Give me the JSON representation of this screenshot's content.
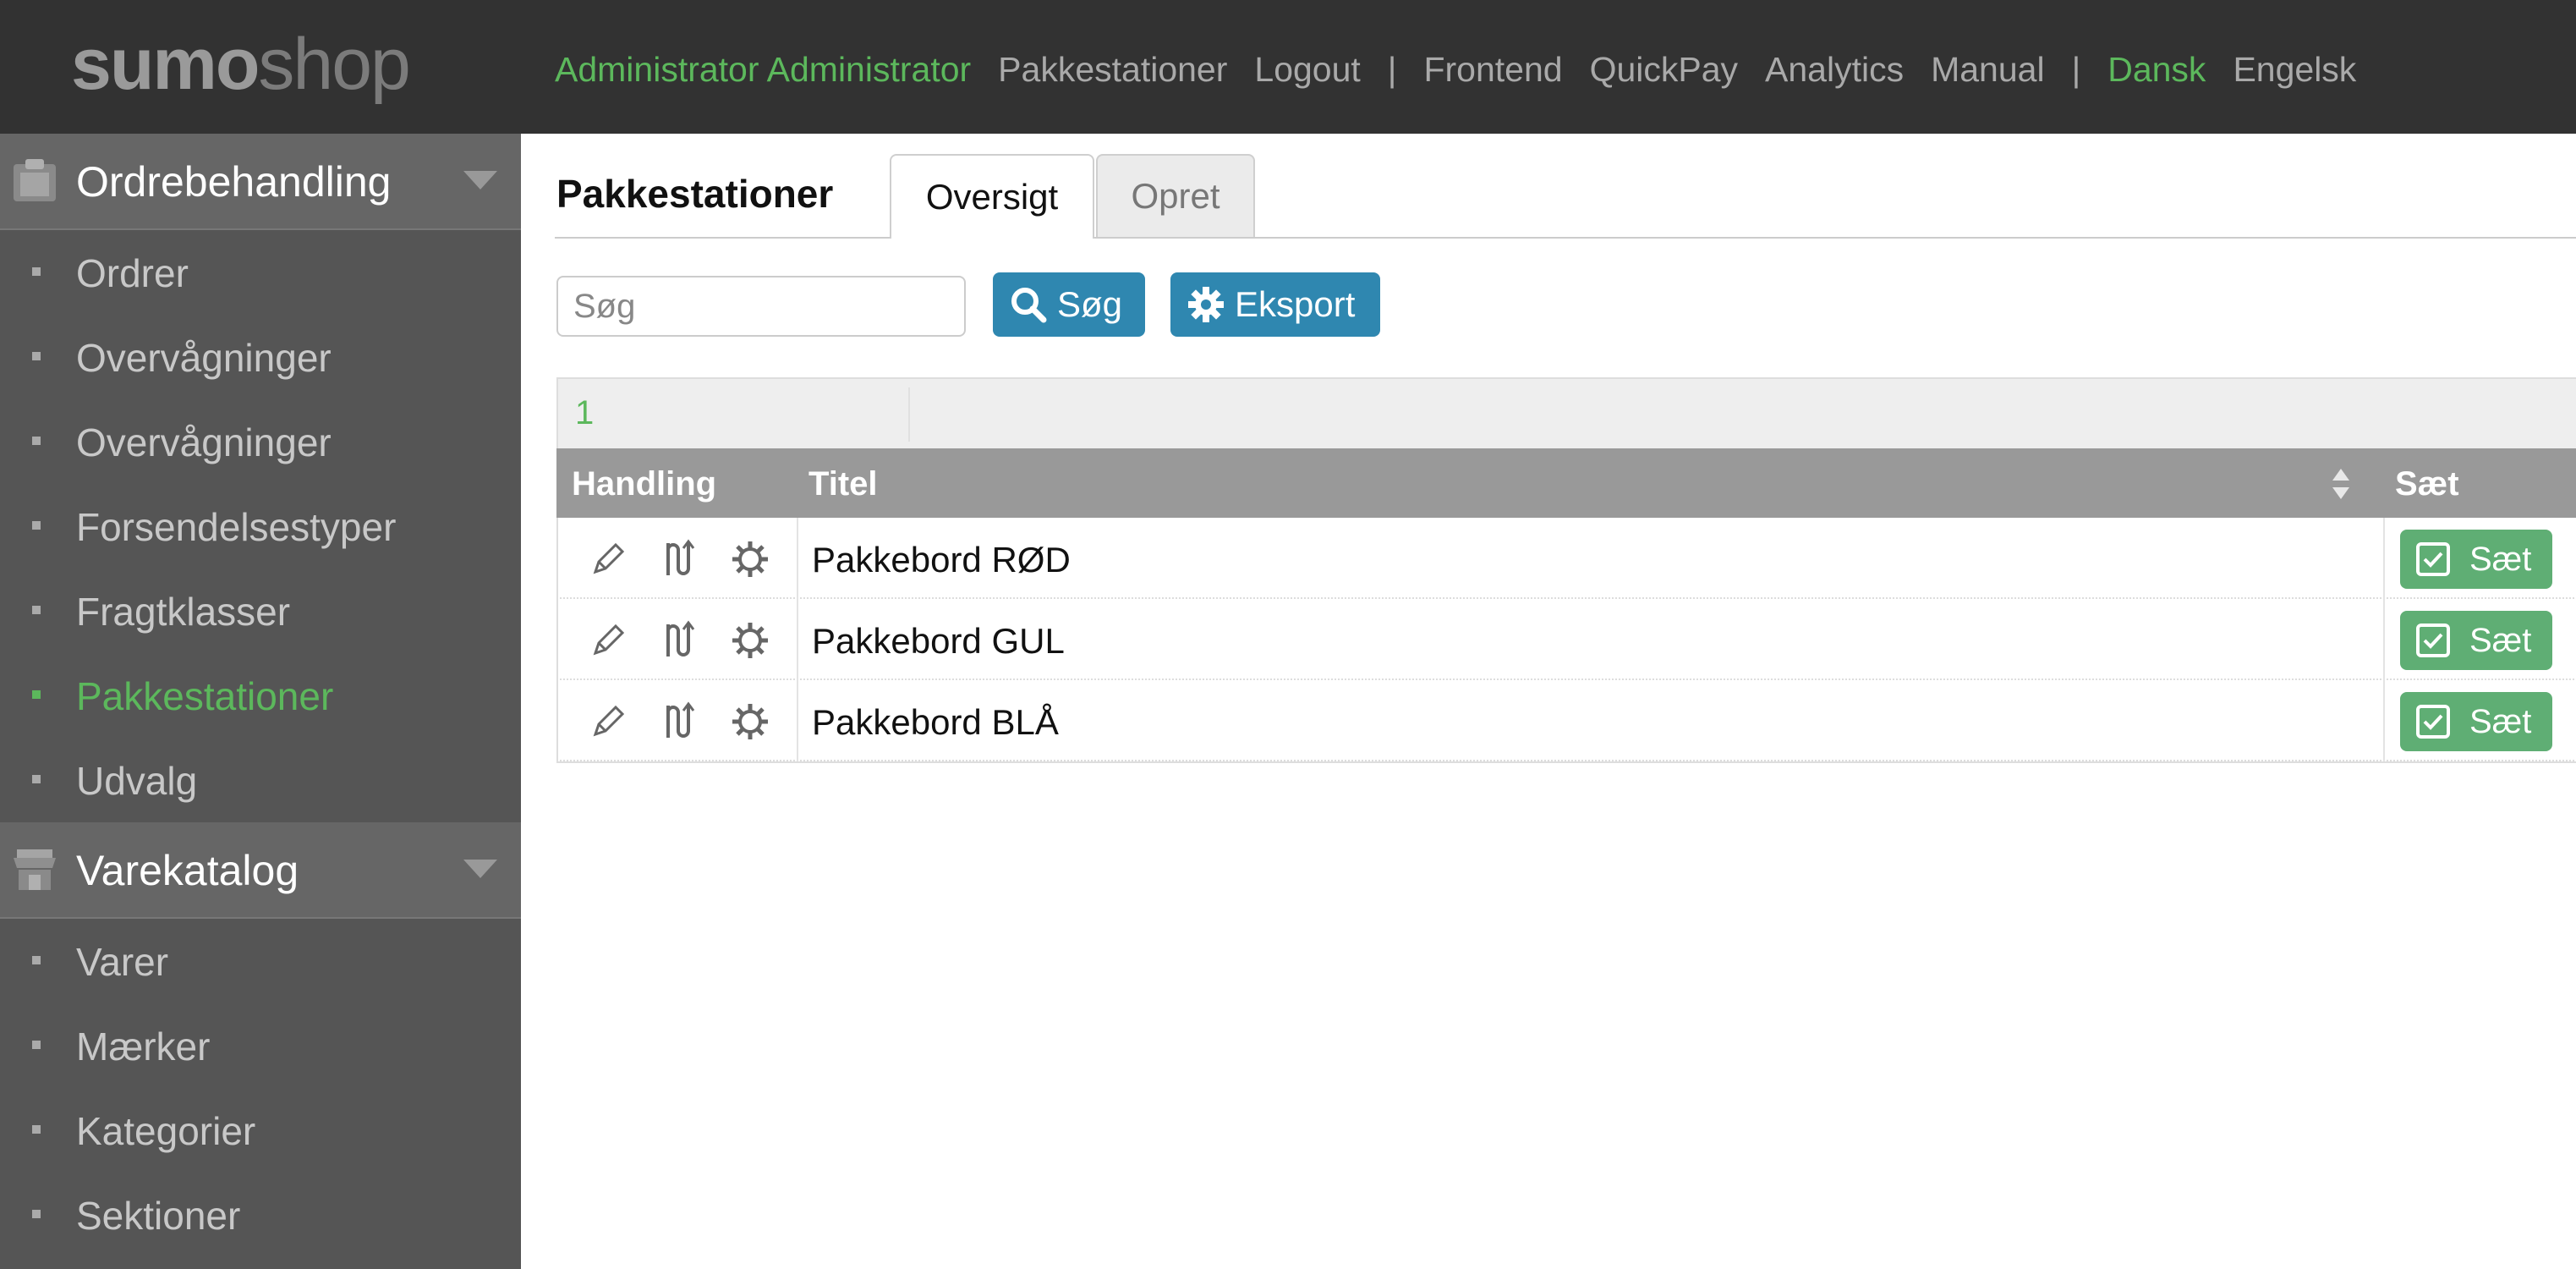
{
  "logo": {
    "part1": "sumo",
    "part2": "shop"
  },
  "topnav": {
    "user": "Administrator Administrator",
    "pakkestationer": "Pakkestationer",
    "logout": "Logout",
    "sep1": "|",
    "frontend": "Frontend",
    "quickpay": "QuickPay",
    "analytics": "Analytics",
    "manual": "Manual",
    "sep2": "|",
    "dansk": "Dansk",
    "engelsk": "Engelsk"
  },
  "sidebar": {
    "section1": {
      "title": "Ordrebehandling",
      "icon": "clipboard-icon"
    },
    "section1_items": [
      {
        "label": "Ordrer"
      },
      {
        "label": "Overvågninger"
      },
      {
        "label": "Overvågninger"
      },
      {
        "label": "Forsendelsestyper"
      },
      {
        "label": "Fragtklasser"
      },
      {
        "label": "Pakkestationer",
        "active": true
      },
      {
        "label": "Udvalg"
      }
    ],
    "section2": {
      "title": "Varekatalog",
      "icon": "store-icon"
    },
    "section2_items": [
      {
        "label": "Varer"
      },
      {
        "label": "Mærker"
      },
      {
        "label": "Kategorier"
      },
      {
        "label": "Sektioner"
      }
    ]
  },
  "main": {
    "title": "Pakkestationer",
    "tabs": [
      {
        "label": "Oversigt"
      },
      {
        "label": "Opret"
      }
    ],
    "search": {
      "placeholder": "Søg",
      "button": "Søg"
    },
    "export_button": "Eksport",
    "pager": {
      "page": "1"
    },
    "table": {
      "headers": {
        "action": "Handling",
        "title": "Titel",
        "set": "Sæt"
      },
      "rows": [
        {
          "title": "Pakkebord RØD",
          "set_label": "Sæt"
        },
        {
          "title": "Pakkebord GUL",
          "set_label": "Sæt"
        },
        {
          "title": "Pakkebord BLÅ",
          "set_label": "Sæt"
        }
      ]
    }
  },
  "colors": {
    "accent_green": "#5cb85c",
    "button_blue": "#2f87b0",
    "set_green": "#5fae74",
    "topbar": "#323232",
    "sidebar": "#555555"
  }
}
